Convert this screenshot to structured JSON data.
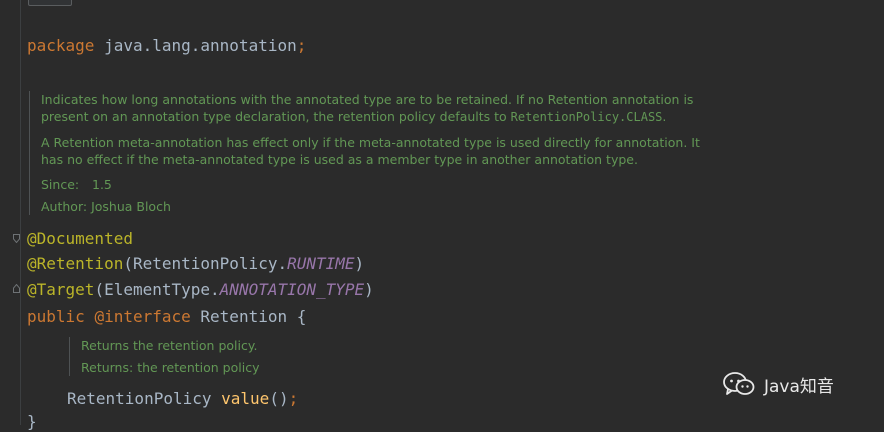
{
  "package_line": {
    "keyword": "package",
    "name": "java.lang.annotation",
    "semicolon": ";"
  },
  "class_doc": {
    "para1_text": "Indicates how long annotations with the annotated type are to be retained. If no Retention annotation is",
    "para1_text2": "present on an annotation type declaration, the retention policy defaults to ",
    "para1_code": "RetentionPolicy.CLASS",
    "para1_end": ".",
    "para2_line1": "A Retention meta-annotation has effect only if the meta-annotated type is used directly for annotation. It",
    "para2_line2": "has no effect if the meta-annotated type is used as a member type in another annotation type.",
    "since_label": "Since:",
    "since_value": "1.5",
    "author_label": "Author:",
    "author_value": "Joshua Bloch"
  },
  "annotations": {
    "documented": "@Documented",
    "retention": "@Retention",
    "retention_open": "(RetentionPolicy.",
    "retention_const": "RUNTIME",
    "retention_close": ")",
    "target": "@Target",
    "target_open": "(ElementType.",
    "target_const": "ANNOTATION_TYPE",
    "target_close": ")"
  },
  "declaration": {
    "public": "public",
    "interface": "@interface",
    "name": "Retention",
    "brace": "{"
  },
  "method_doc": {
    "line1": "Returns the retention policy.",
    "returns_label": "Returns:",
    "returns_value": "the retention policy"
  },
  "method": {
    "type": "RetentionPolicy",
    "name": "value",
    "parens": "()",
    "semicolon": ";"
  },
  "closing_brace": "}",
  "watermark": {
    "icon": "wechat-icon",
    "text": "Java知音"
  }
}
